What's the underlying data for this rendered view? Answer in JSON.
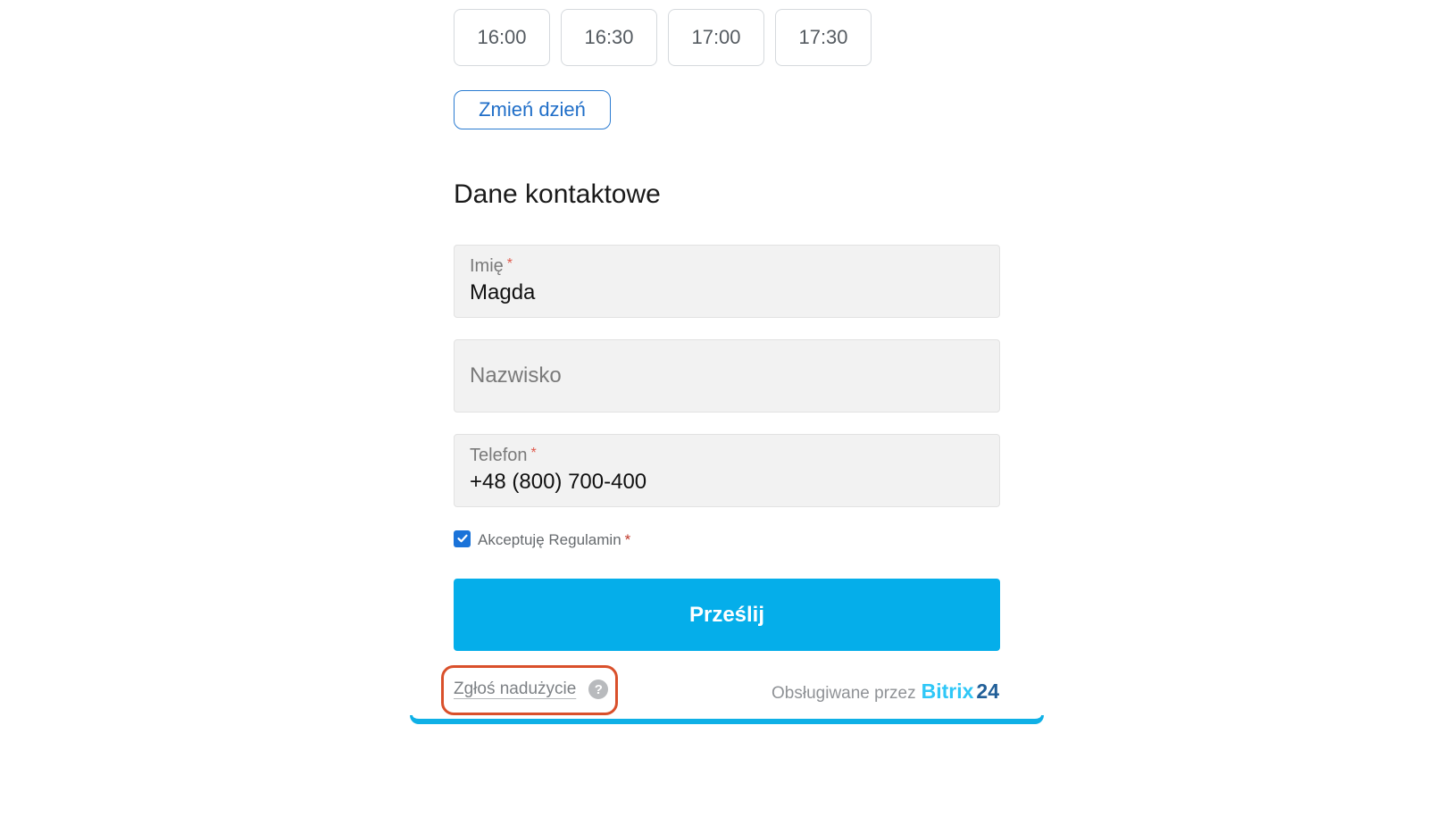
{
  "time_slots": [
    "16:00",
    "16:30",
    "17:00",
    "17:30"
  ],
  "change_day_label": "Zmień dzień",
  "section_title": "Dane kontaktowe",
  "fields": {
    "imie": {
      "label": "Imię",
      "required_mark": "*",
      "value": "Magda"
    },
    "nazwisko": {
      "placeholder": "Nazwisko"
    },
    "telefon": {
      "label": "Telefon",
      "required_mark": "*",
      "value": "+48 (800) 700-400"
    }
  },
  "consent": {
    "label": "Akceptuję Regulamin",
    "required_mark": "*",
    "checked": true
  },
  "submit_label": "Prześlij",
  "footer": {
    "report_label": "Zgłoś nadużycie",
    "help_icon": "?",
    "powered_by": "Obsługiwane przez",
    "brand_name": "Bitrix",
    "brand_number": "24"
  },
  "colors": {
    "accent_blue": "#05aeea",
    "link_blue": "#1f6ec8",
    "required_red": "#e05a4d",
    "highlight_orange": "#d9502b"
  }
}
